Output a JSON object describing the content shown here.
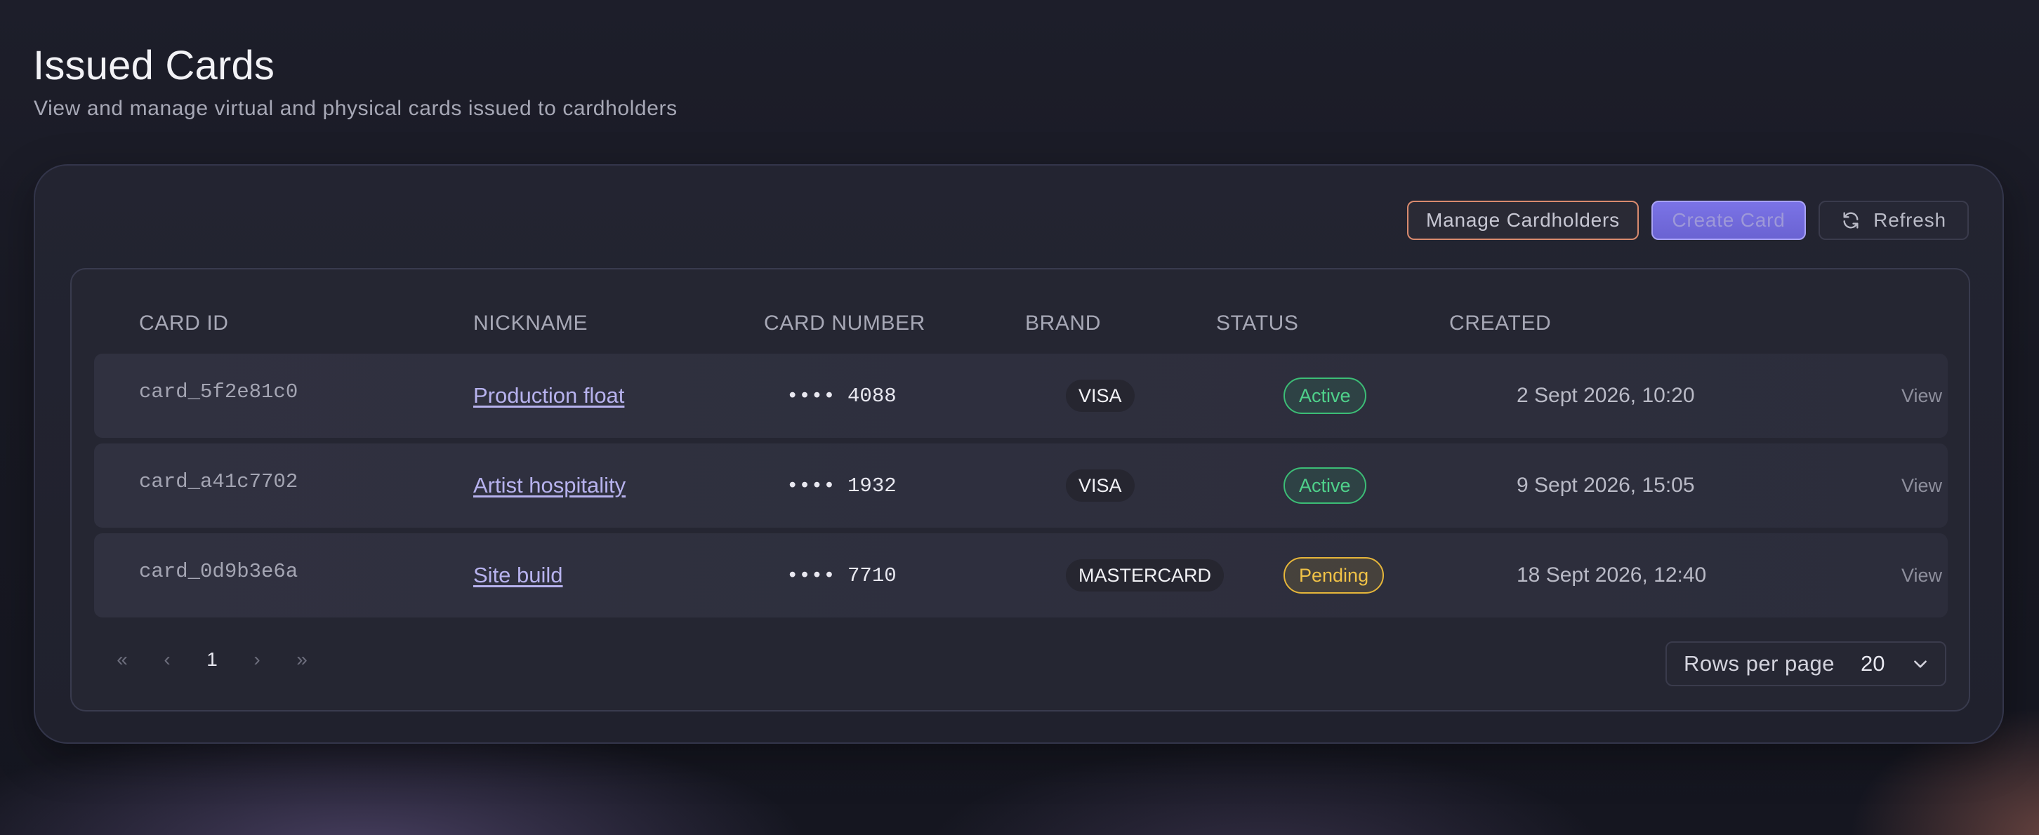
{
  "page": {
    "title": "Issued Cards",
    "subtitle": "View and manage virtual and physical cards issued to cardholders"
  },
  "toolbar": {
    "manage_label": "Manage Cardholders",
    "create_label": "Create Card",
    "refresh_label": "Refresh"
  },
  "table": {
    "columns": [
      "CARD ID",
      "NICKNAME",
      "CARD NUMBER",
      "BRAND",
      "STATUS",
      "CREATED"
    ],
    "rows": [
      {
        "card_id": "card_5f2e81c0",
        "nickname": "Production float",
        "card_number": "•••• 4088",
        "brand": "VISA",
        "status": "Active",
        "created": "2 Sept 2026, 10:20",
        "action": "View"
      },
      {
        "card_id": "card_a41c7702",
        "nickname": "Artist hospitality",
        "card_number": "•••• 1932",
        "brand": "VISA",
        "status": "Active",
        "created": "9 Sept 2026, 15:05",
        "action": "View"
      },
      {
        "card_id": "card_0d9b3e6a",
        "nickname": "Site build",
        "card_number": "•••• 7710",
        "brand": "MASTERCARD",
        "status": "Pending",
        "created": "18 Sept 2026, 12:40",
        "action": "View"
      }
    ]
  },
  "pagination": {
    "first": "«",
    "prev": "‹",
    "current_page": "1",
    "next": "›",
    "last": "»",
    "rows_per_page_label": "Rows per page",
    "rows_per_page_value": "20"
  },
  "icons": {
    "refresh": "refresh-icon",
    "chevron": "chevron-down-icon"
  },
  "colors": {
    "accent": "#7b73e6",
    "active": "#3cbd76",
    "pending": "#e6b63a",
    "manage_border": "#d88a6e"
  }
}
